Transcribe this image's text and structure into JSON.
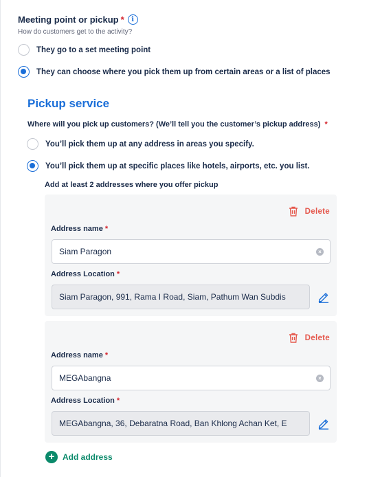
{
  "meeting": {
    "label": "Meeting point or pickup",
    "required_mark": "*",
    "info_glyph": "i",
    "hint": "How do customers get to the activity?",
    "options": [
      {
        "label": "They go to a set meeting point",
        "checked": false
      },
      {
        "label": "They can choose where you pick them up from certain areas or a list of places",
        "checked": true
      }
    ]
  },
  "pickup": {
    "title": "Pickup service",
    "question": "Where will you pick up customers? (We’ll tell you the customer’s pickup address)",
    "required_mark": "*",
    "options": [
      {
        "label": "You’ll pick them up at any address in areas you specify.",
        "checked": false
      },
      {
        "label": "You’ll pick them up at specific places like hotels, airports, etc. you list.",
        "checked": true
      }
    ],
    "sub_hint": "Add at least 2 addresses where you offer pickup"
  },
  "addresses": [
    {
      "delete_label": "Delete",
      "name_label": "Address name",
      "name_value": "Siam Paragon",
      "location_label": "Address Location",
      "location_value": "Siam Paragon, 991, Rama I Road, Siam, Pathum Wan Subdis"
    },
    {
      "delete_label": "Delete",
      "name_label": "Address name",
      "name_value": "MEGAbangna",
      "location_label": "Address Location",
      "location_value": "MEGAbangna, 36, Debaratna Road, Ban Khlong Achan Ket, E"
    }
  ],
  "add_address_label": "Add address",
  "icons": {
    "info": "info-icon",
    "trash": "trash-icon",
    "clear": "clear-icon",
    "edit": "pencil-icon",
    "add": "plus-circle-icon"
  },
  "colors": {
    "primary": "#1a6ed8",
    "danger": "#e5584d",
    "required": "#d4232c",
    "add": "#0b8a6b",
    "text": "#1a2b49"
  }
}
